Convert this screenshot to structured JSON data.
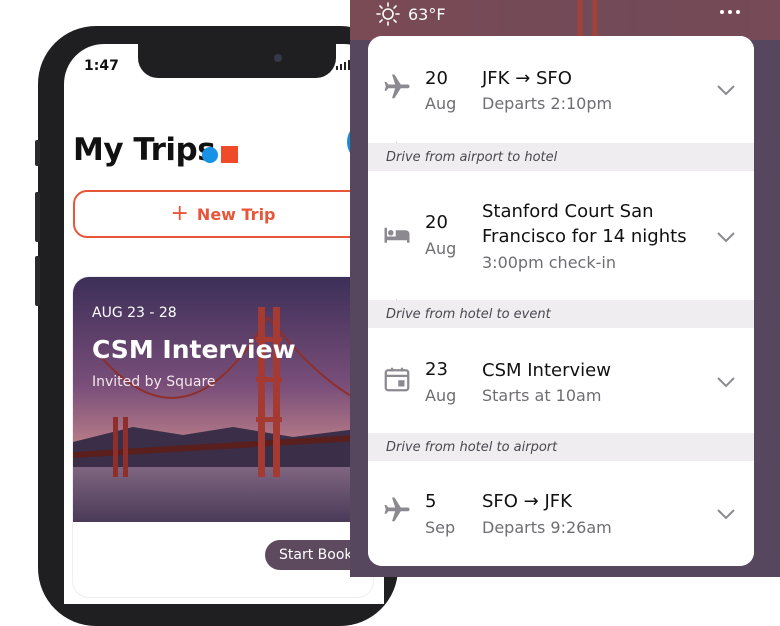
{
  "phone": {
    "status_time": "1:47",
    "title": "My Trips",
    "new_trip_label": "New Trip",
    "trip_card": {
      "dates": "AUG 23 - 28",
      "name": "CSM Interview",
      "invited_by": "Invited by Square"
    },
    "start_booking_label": "Start Bookin"
  },
  "panel": {
    "weather": "63°F",
    "itinerary": [
      {
        "type": "flight",
        "day": "20",
        "month": "Aug",
        "title": "JFK → SFO",
        "subtitle": "Departs 2:10pm"
      },
      {
        "type": "drive",
        "label": "Drive from airport to hotel"
      },
      {
        "type": "hotel",
        "day": "20",
        "month": "Aug",
        "title_line1": "Stanford Court San",
        "title_line2": "Francisco for 14 nights",
        "subtitle": "3:00pm check-in"
      },
      {
        "type": "drive",
        "label": "Drive from hotel to event"
      },
      {
        "type": "event",
        "day": "23",
        "month": "Aug",
        "title": "CSM Interview",
        "subtitle": "Starts at 10am"
      },
      {
        "type": "drive",
        "label": "Drive from hotel to airport"
      },
      {
        "type": "flight",
        "day": "5",
        "month": "Sep",
        "title": "SFO → JFK",
        "subtitle": "Departs 9:26am"
      }
    ]
  },
  "colors": {
    "accent_orange": "#e8563a",
    "logo_blue": "#1793e6",
    "logo_red": "#ef4b2a",
    "panel_purple": "#5b4a63"
  }
}
